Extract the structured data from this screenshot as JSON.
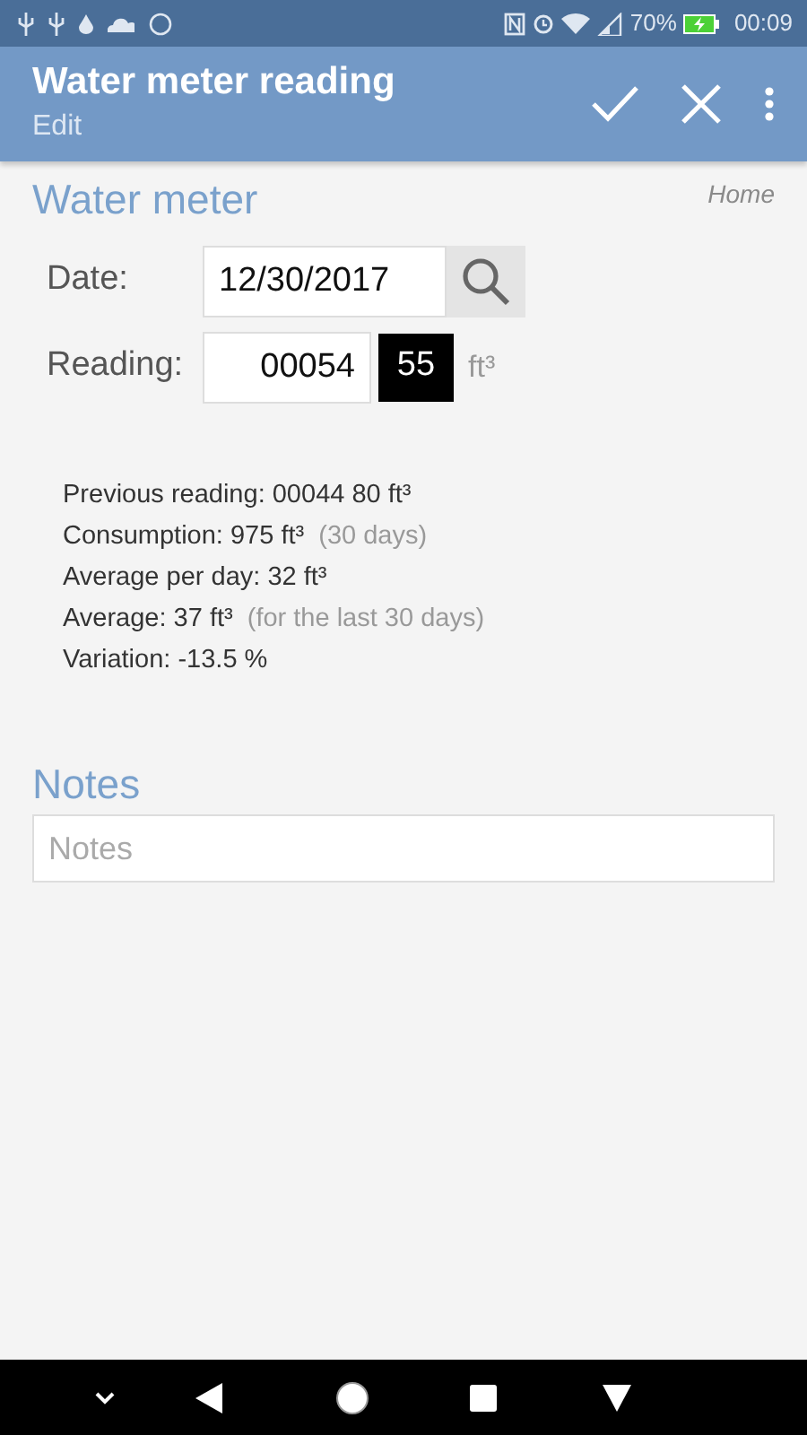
{
  "status_bar": {
    "battery": "70%",
    "time": "00:09"
  },
  "toolbar": {
    "title": "Water meter reading",
    "subtitle": "Edit"
  },
  "section": {
    "title": "Water meter",
    "tag": "Home"
  },
  "date": {
    "label": "Date:",
    "value": "12/30/2017"
  },
  "reading": {
    "label": "Reading:",
    "integer": "00054",
    "decimal": "55",
    "unit": "ft³"
  },
  "stats": [
    {
      "text": "Previous reading: 00044 80 ft³"
    },
    {
      "text": "Consumption: 975 ft³",
      "note": "(30 days)"
    },
    {
      "text": "Average per day: 32 ft³"
    },
    {
      "text": "Average: 37 ft³",
      "note": "(for the last 30 days)"
    },
    {
      "text": "Variation: -13.5 %"
    }
  ],
  "notes": {
    "title": "Notes",
    "placeholder": "Notes"
  }
}
